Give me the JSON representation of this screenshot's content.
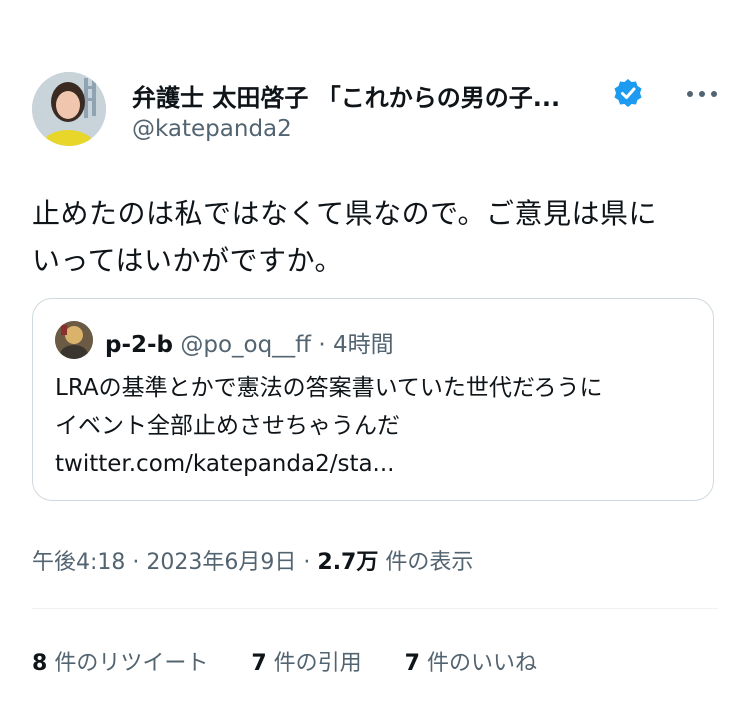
{
  "author": {
    "name": "弁護士 太田啓子 「これからの男の子...",
    "handle": "@katepanda2",
    "verified_color": "#1d9bf0"
  },
  "tweet": {
    "text_line1": "止めたのは私ではなくて県なので。ご意見は県に",
    "text_line2": "いってはいかがですか。"
  },
  "quote": {
    "name": "p-2-b",
    "handle": "@po_oq__ff",
    "separator": "·",
    "time": "4時間",
    "text_line1": "LRAの基準とかで憲法の答案書いていた世代だろうに",
    "text_line2": "イベント全部止めさせちゃうんだ",
    "text_line3": "twitter.com/katepanda2/sta..."
  },
  "meta": {
    "time": "午後4:18",
    "sep1": "·",
    "date": "2023年6月9日",
    "sep2": "·",
    "views_count": "2.7万",
    "views_label": "件の表示"
  },
  "stats": {
    "retweets_count": "8",
    "retweets_label": "件のリツイート",
    "quotes_count": "7",
    "quotes_label": "件の引用",
    "likes_count": "7",
    "likes_label": "件のいいね"
  },
  "icons": {
    "more": "ellipsis-icon",
    "verified": "verified-badge-icon"
  },
  "colors": {
    "text_primary": "#0f1419",
    "text_secondary": "#536471",
    "border": "#cfd9de",
    "accent": "#1d9bf0"
  }
}
